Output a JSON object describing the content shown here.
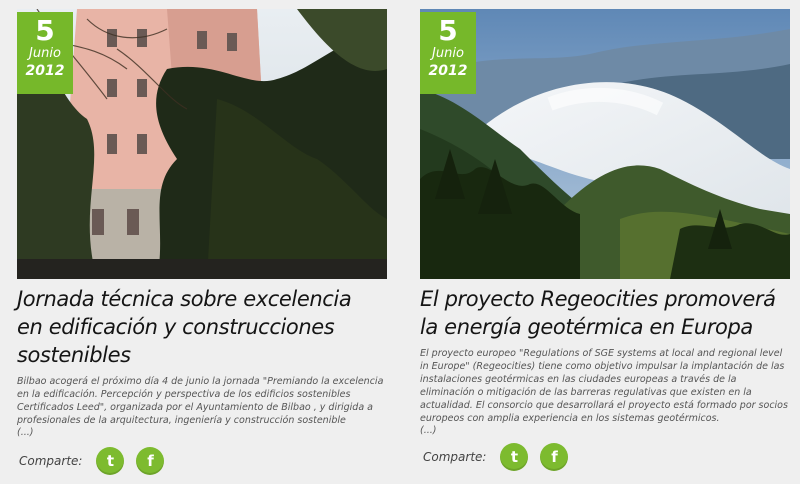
{
  "colors": {
    "accent": "#76b82a",
    "background": "#efefef",
    "title_text": "#151515",
    "body_text": "#555555"
  },
  "articles": [
    {
      "date": {
        "day": "5",
        "month": "Junio",
        "year": "2012"
      },
      "photo_subject": "building-with-trees-photo",
      "title_lines": [
        "Jornada técnica sobre excelencia",
        "en edificación y construcciones",
        "sostenibles"
      ],
      "body": "Bilbao acogerá el próximo día 4 de junio la jornada \"Premiando la excelencia en la edificación. Percepción y perspectiva de los edificios sostenibles Certificados Leed\", organizada por el Ayuntamiento de Bilbao , y dirigida a profesionales de la arquitectura, ingeniería y construcción sostenible",
      "more": "(...)",
      "share_label": "Comparte:",
      "share_icons": [
        "twitter-icon",
        "facebook-icon"
      ]
    },
    {
      "date": {
        "day": "5",
        "month": "Junio",
        "year": "2012"
      },
      "photo_subject": "mountain-valley-fog-photo",
      "title_lines": [
        "El proyecto Regeocities promoverá",
        "la energía geotérmica en Europa"
      ],
      "body": "El proyecto europeo \"Regulations of SGE systems at local and regional level in Europe\" (Regeocities) tiene como objetivo impulsar la implantación de las instalaciones geotérmicas en las ciudades europeas a través de la eliminación o mitigación de las barreras regulativas que existen en la actualidad. El consorcio que desarrollará el proyecto está formado por socios europeos con amplia experiencia en los sistemas geotérmicos.",
      "more": "(...)",
      "share_label": "Comparte:",
      "share_icons": [
        "twitter-icon",
        "facebook-icon"
      ]
    }
  ],
  "icon_glyphs": {
    "twitter": "t",
    "facebook": "f"
  }
}
